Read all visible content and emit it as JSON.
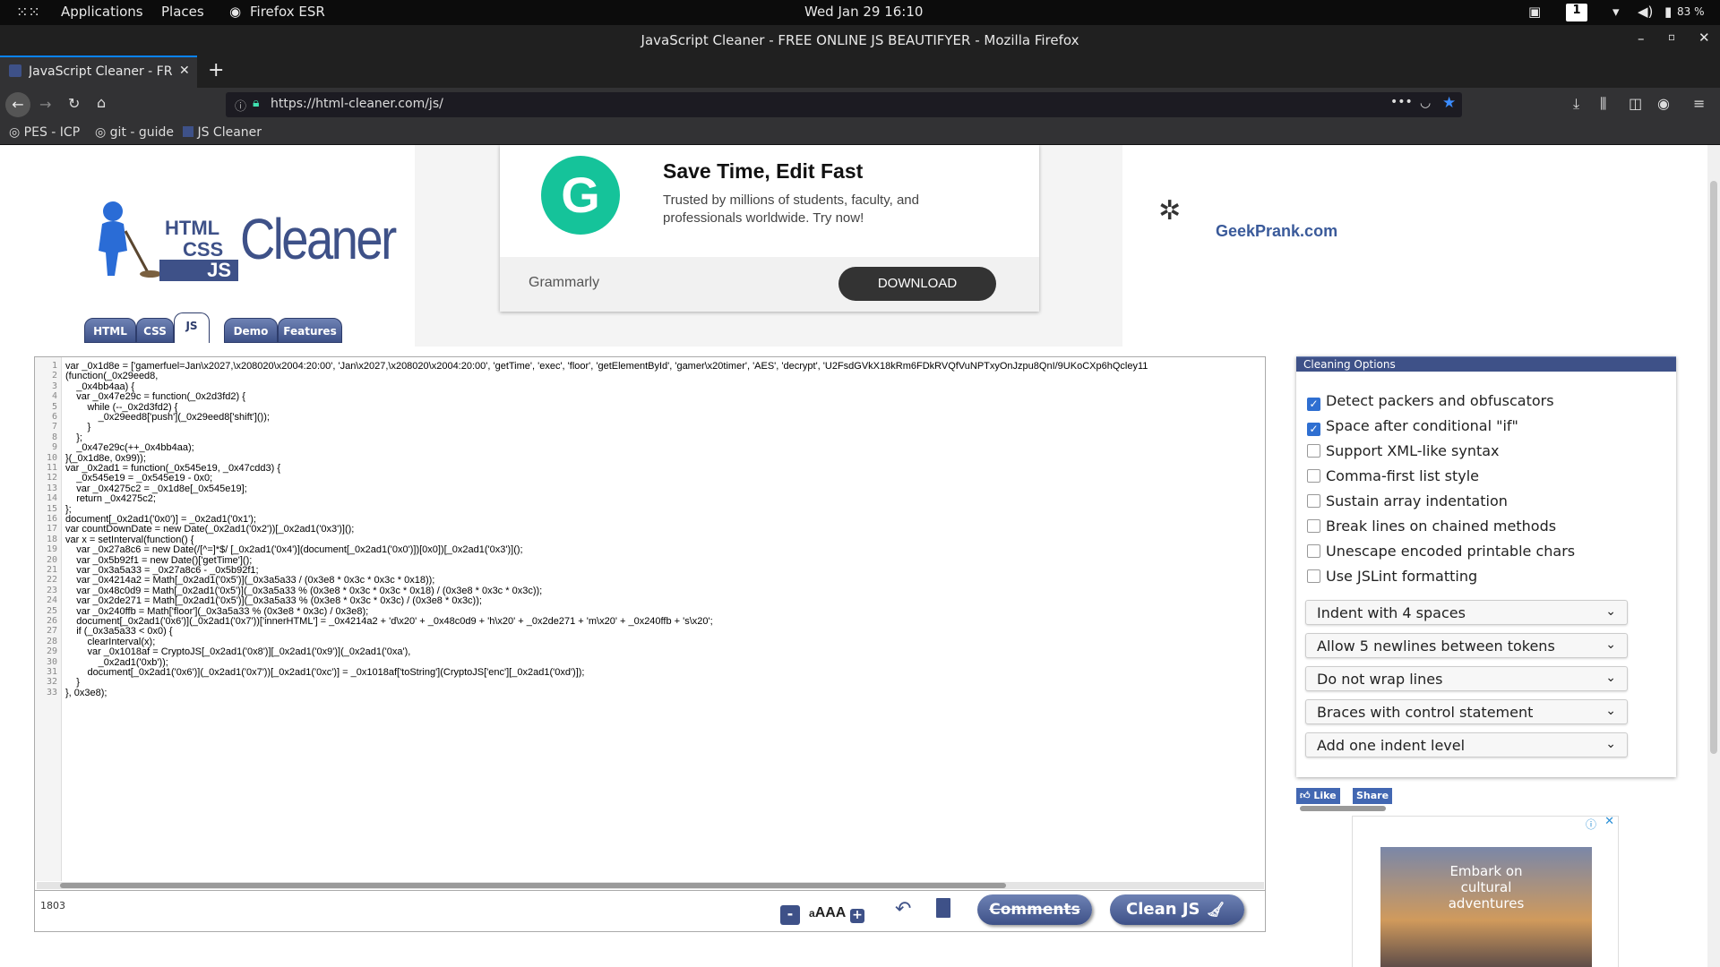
{
  "os": {
    "applications": "Applications",
    "places": "Places",
    "browser_app": "Firefox ESR",
    "clock": "Wed Jan 29  16:10",
    "workspace": "1",
    "battery": "83 %"
  },
  "window": {
    "title": "JavaScript Cleaner - FREE ONLINE JS BEAUTIFYER - Mozilla Firefox"
  },
  "tab": {
    "label": "JavaScript Cleaner - FRE"
  },
  "url": "https://html-cleaner.com/js/",
  "bookmarks": [
    "PES - ICP",
    "git - guide",
    "JS Cleaner"
  ],
  "logo": {
    "html": "HTML",
    "css": "CSS",
    "js": "JS",
    "cleaner": "Cleaner"
  },
  "site_tabs": [
    "HTML",
    "CSS",
    "JS",
    "Demo",
    "Features"
  ],
  "ad": {
    "headline": "Save Time, Edit Fast",
    "body": "Trusted by millions of students, faculty, and professionals worldwide. Try now!",
    "brand": "Grammarly",
    "cta": "DOWNLOAD"
  },
  "geekprank": "GeekPrank.com",
  "code": {
    "line_numbers": [
      "1",
      "2",
      "3",
      "4",
      "5",
      "6",
      "7",
      "8",
      "9",
      "10",
      "11",
      "12",
      "13",
      "14",
      "15",
      "16",
      "17",
      "18",
      "19",
      "20",
      "21",
      "22",
      "23",
      "24",
      "25",
      "26",
      "27",
      "28",
      "29",
      "30",
      "31",
      "32",
      "33"
    ],
    "lines": [
      "var _0x1d8e = ['gamerfuel=Jan\\x2027,\\x208020\\x2004:20:00', 'Jan\\x2027,\\x208020\\x2004:20:00', 'getTime', 'exec', 'floor', 'getElementById', 'gamer\\x20timer', 'AES', 'decrypt', 'U2FsdGVkX18kRm6FDkRVQfVuNPTxyOnJzpu8QnI/9UKoCXp6hQcley11",
      "(function(_0x29eed8,",
      "    _0x4bb4aa) {",
      "    var _0x47e29c = function(_0x2d3fd2) {",
      "        while (--_0x2d3fd2) {",
      "            _0x29eed8['push'](_0x29eed8['shift']());",
      "        }",
      "    };",
      "    _0x47e29c(++_0x4bb4aa);",
      "}(_0x1d8e, 0x99));",
      "var _0x2ad1 = function(_0x545e19, _0x47cdd3) {",
      "    _0x545e19 = _0x545e19 - 0x0;",
      "    var _0x4275c2 = _0x1d8e[_0x545e19];",
      "    return _0x4275c2;",
      "};",
      "document[_0x2ad1('0x0')] = _0x2ad1('0x1');",
      "var countDownDate = new Date(_0x2ad1('0x2'))[_0x2ad1('0x3')]();",
      "var x = setInterval(function() {",
      "    var _0x27a8c6 = new Date(/[^=]*$/ [_0x2ad1('0x4')](document[_0x2ad1('0x0')])[0x0])[_0x2ad1('0x3')]();",
      "    var _0x5b92f1 = new Date()['getTime']();",
      "    var _0x3a5a33 = _0x27a8c6 - _0x5b92f1;",
      "    var _0x4214a2 = Math[_0x2ad1('0x5')](_0x3a5a33 / (0x3e8 * 0x3c * 0x3c * 0x18));",
      "    var _0x48c0d9 = Math[_0x2ad1('0x5')](_0x3a5a33 % (0x3e8 * 0x3c * 0x3c * 0x18) / (0x3e8 * 0x3c * 0x3c));",
      "    var _0x2de271 = Math[_0x2ad1('0x5')](_0x3a5a33 % (0x3e8 * 0x3c * 0x3c) / (0x3e8 * 0x3c));",
      "    var _0x240ffb = Math['floor'](_0x3a5a33 % (0x3e8 * 0x3c) / 0x3e8);",
      "    document[_0x2ad1('0x6')](_0x2ad1('0x7'))['innerHTML'] = _0x4214a2 + 'd\\x20' + _0x48c0d9 + 'h\\x20' + _0x2de271 + 'm\\x20' + _0x240ffb + 's\\x20';",
      "    if (_0x3a5a33 < 0x0) {",
      "        clearInterval(x);",
      "        var _0x1018af = CryptoJS[_0x2ad1('0x8')][_0x2ad1('0x9')](_0x2ad1('0xa'),",
      "            _0x2ad1('0xb'));",
      "        document[_0x2ad1('0x6')](_0x2ad1('0x7'))[_0x2ad1('0xc')] = _0x1018af['toString'](CryptoJS['enc'][_0x2ad1('0xd')]);",
      "    }",
      "}, 0x3e8);"
    ]
  },
  "footer": {
    "char_count": "1803",
    "minus": "-",
    "font_size_label": "AAA",
    "plus": "+",
    "comments": "Comments",
    "clean": "Clean JS"
  },
  "options": {
    "title": "Cleaning Options",
    "checkboxes": [
      {
        "label": "Detect packers and obfuscators",
        "checked": true
      },
      {
        "label": "Space after conditional \"if\"",
        "checked": true
      },
      {
        "label": "Support XML-like syntax",
        "checked": false
      },
      {
        "label": "Comma-first list style",
        "checked": false
      },
      {
        "label": "Sustain array indentation",
        "checked": false
      },
      {
        "label": "Break lines on chained methods",
        "checked": false
      },
      {
        "label": "Unescape encoded printable chars",
        "checked": false
      },
      {
        "label": "Use JSLint formatting",
        "checked": false
      }
    ],
    "selects": [
      "Indent with 4 spaces",
      "Allow 5 newlines between tokens",
      "Do not wrap lines",
      "Braces with control statement",
      "Add one indent level"
    ]
  },
  "social": {
    "like": "Like",
    "share": "Share"
  },
  "ad2": {
    "text": "Embark on cultural adventures"
  },
  "colors": {
    "accent": "#3e5188",
    "firefox_blue": "#0a84ff",
    "grammarly": "#15c39a"
  }
}
